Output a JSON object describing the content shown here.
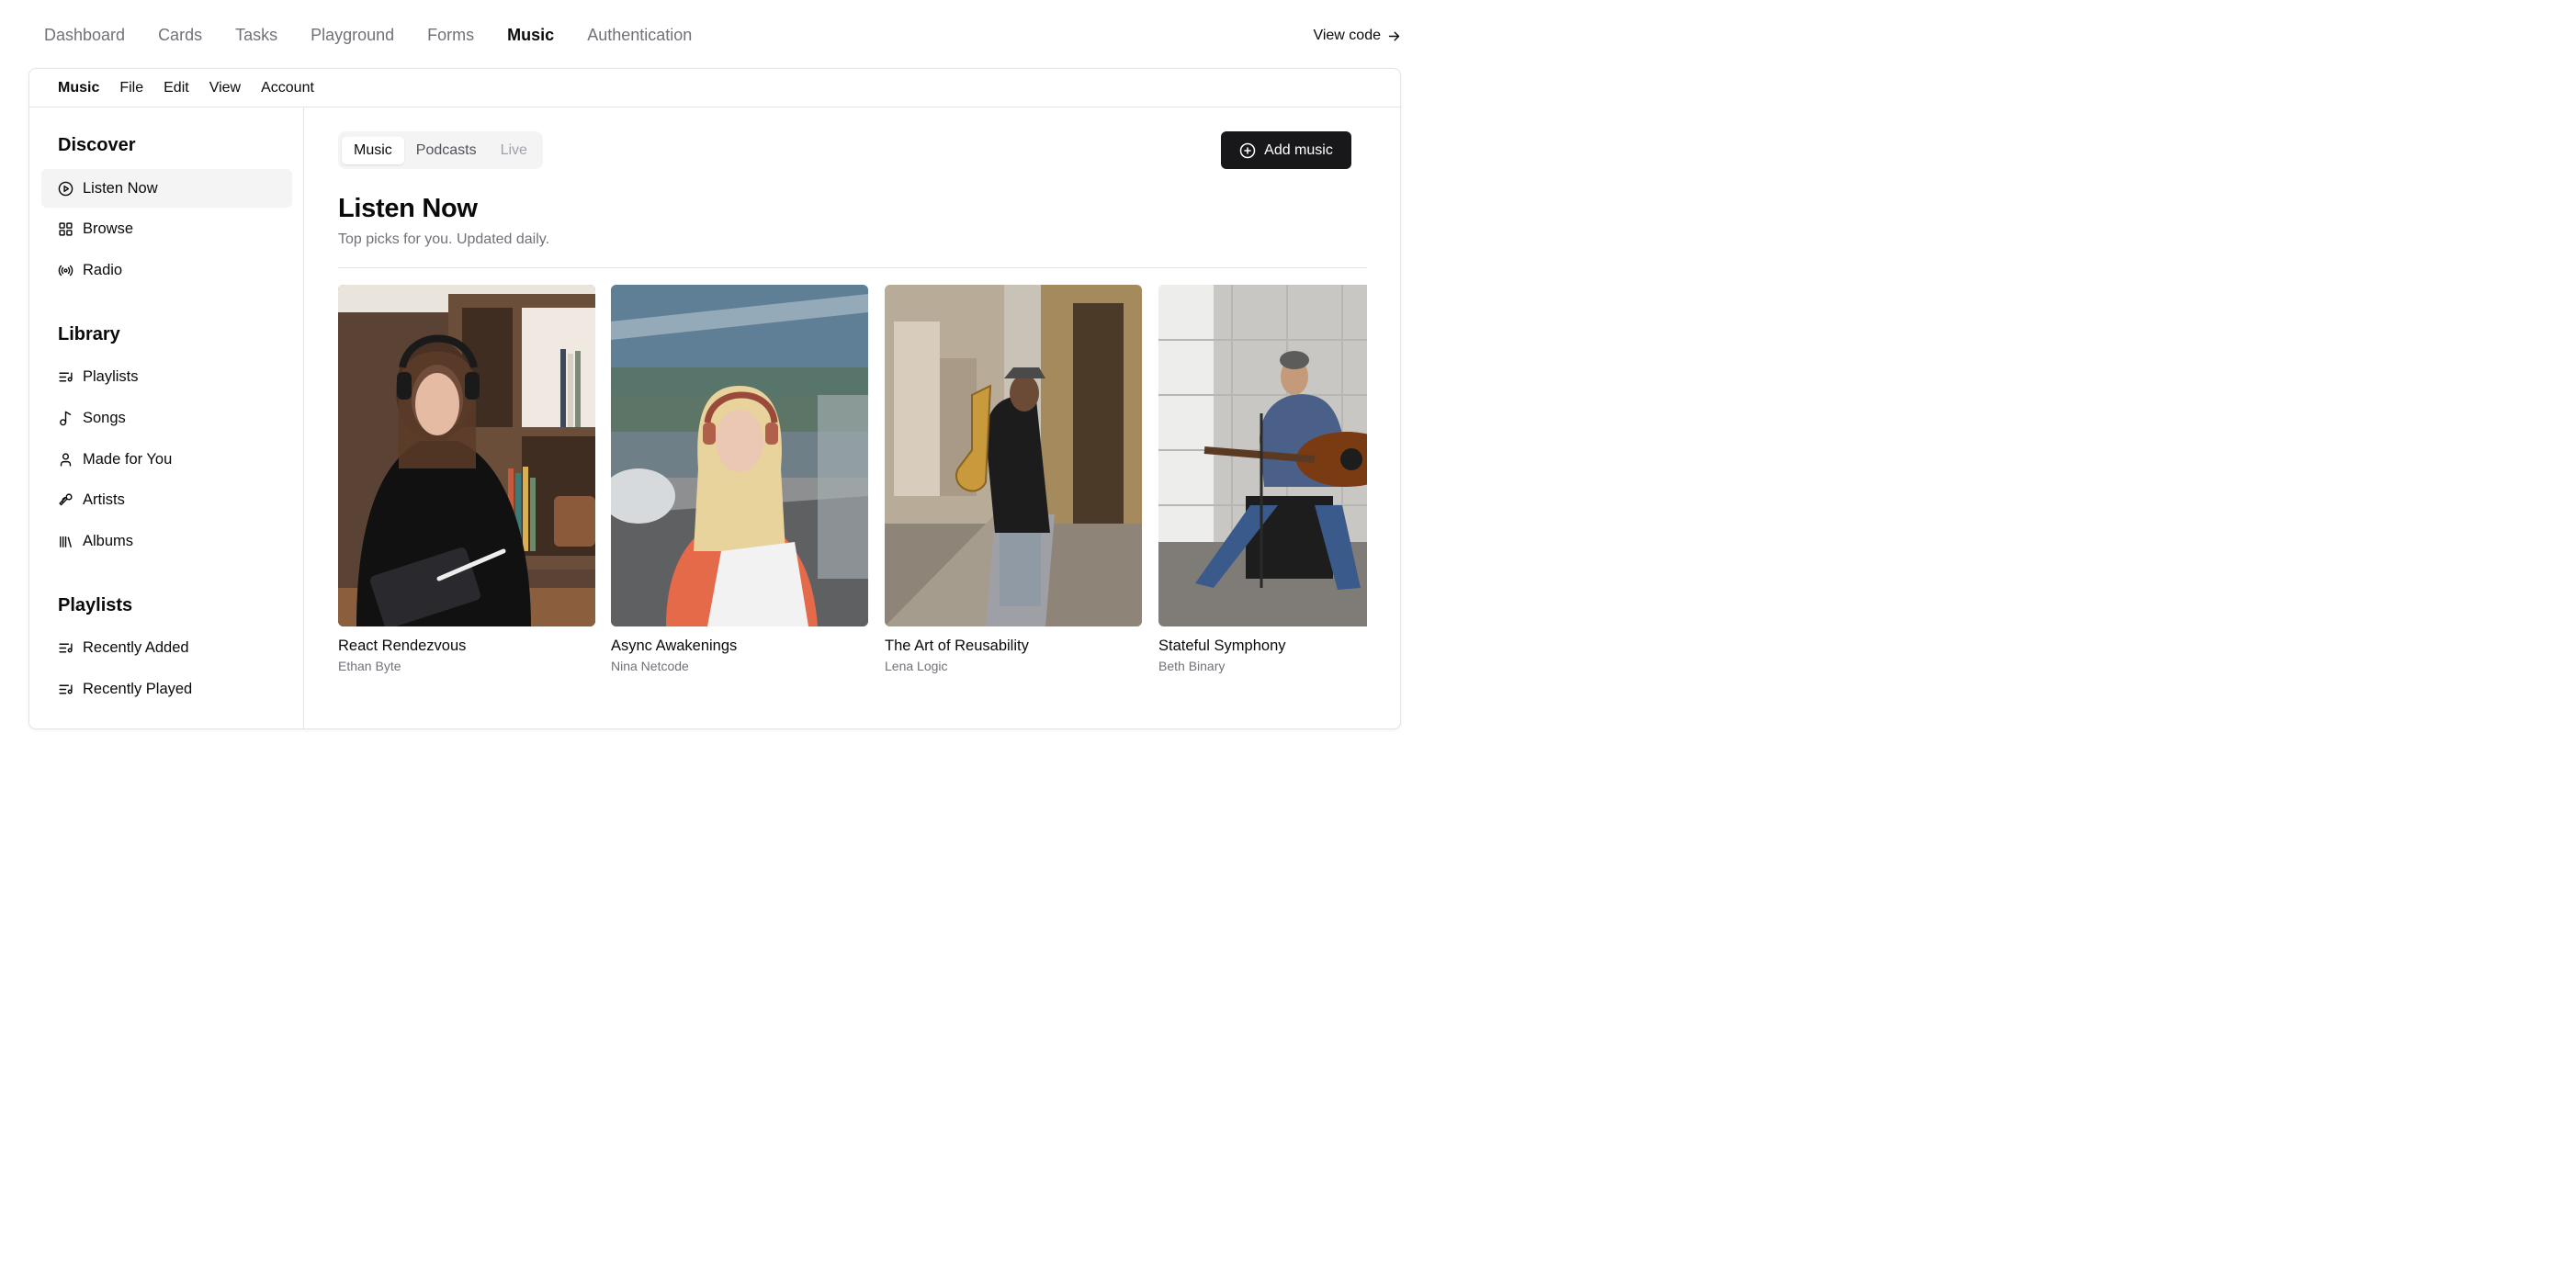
{
  "topnav": {
    "items": [
      {
        "label": "Dashboard",
        "active": false
      },
      {
        "label": "Cards",
        "active": false
      },
      {
        "label": "Tasks",
        "active": false
      },
      {
        "label": "Playground",
        "active": false
      },
      {
        "label": "Forms",
        "active": false
      },
      {
        "label": "Music",
        "active": true
      },
      {
        "label": "Authentication",
        "active": false
      }
    ],
    "view_code": "View code"
  },
  "menubar": {
    "items": [
      "Music",
      "File",
      "Edit",
      "View",
      "Account"
    ]
  },
  "sidebar": {
    "discover": {
      "title": "Discover",
      "items": [
        {
          "label": "Listen Now",
          "icon": "play-circle-icon",
          "active": true
        },
        {
          "label": "Browse",
          "icon": "grid-icon",
          "active": false
        },
        {
          "label": "Radio",
          "icon": "radio-icon",
          "active": false
        }
      ]
    },
    "library": {
      "title": "Library",
      "items": [
        {
          "label": "Playlists",
          "icon": "list-music-icon"
        },
        {
          "label": "Songs",
          "icon": "music-note-icon"
        },
        {
          "label": "Made for You",
          "icon": "user-icon"
        },
        {
          "label": "Artists",
          "icon": "microphone-icon"
        },
        {
          "label": "Albums",
          "icon": "library-icon"
        }
      ]
    },
    "playlists": {
      "title": "Playlists",
      "items": [
        {
          "label": "Recently Added",
          "icon": "list-music-icon"
        },
        {
          "label": "Recently Played",
          "icon": "list-music-icon"
        }
      ]
    }
  },
  "main": {
    "tabs": [
      {
        "label": "Music",
        "state": "active"
      },
      {
        "label": "Podcasts",
        "state": "normal"
      },
      {
        "label": "Live",
        "state": "disabled"
      }
    ],
    "add_button": "Add music",
    "heading": "Listen Now",
    "subheading": "Top picks for you. Updated daily.",
    "albums": [
      {
        "title": "React Rendezvous",
        "artist": "Ethan Byte"
      },
      {
        "title": "Async Awakenings",
        "artist": "Nina Netcode"
      },
      {
        "title": "The Art of Reusability",
        "artist": "Lena Logic"
      },
      {
        "title": "Stateful Symphony",
        "artist": "Beth Binary"
      }
    ]
  },
  "colors": {
    "accent": "#18181b",
    "muted": "#71717a",
    "border": "#e4e4e7",
    "hover_bg": "#f4f4f5"
  }
}
